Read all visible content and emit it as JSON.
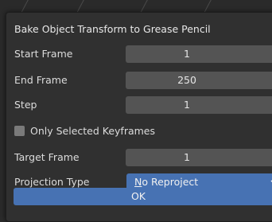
{
  "dialog": {
    "title": "Bake Object Transform to Grease Pencil",
    "fields": {
      "start_frame": {
        "label": "Start Frame",
        "value": "1"
      },
      "end_frame": {
        "label": "End Frame",
        "value": "250"
      },
      "step": {
        "label": "Step",
        "value": "1"
      },
      "only_selected_keyframes": {
        "label": "Only Selected Keyframes",
        "checked": false
      },
      "target_frame": {
        "label": "Target Frame",
        "value": "1"
      },
      "projection_type": {
        "label": "Projection Type",
        "value": "No Reproject",
        "icon": "chevron-down-icon"
      }
    },
    "ok_label": "OK"
  },
  "colors": {
    "accent": "#4772b3",
    "field_bg": "#545454",
    "dialog_bg": "#303030"
  }
}
